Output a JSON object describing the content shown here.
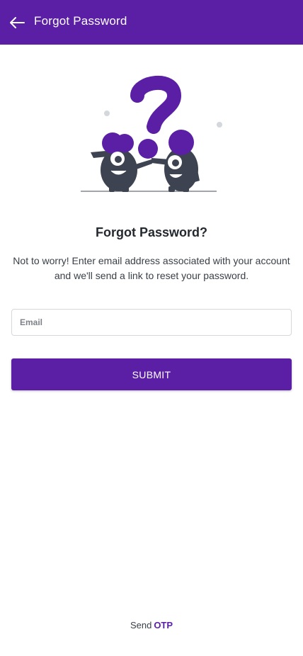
{
  "app_bar": {
    "title": "Forgot Password",
    "back_icon": "arrow-left-icon",
    "color": "#5b1fa6"
  },
  "illustration": {
    "name": "question-mark-monsters-illustration",
    "accent": "#5b1fa6",
    "body_color": "#3d4350"
  },
  "content": {
    "heading": "Forgot Password?",
    "description": "Not to worry! Enter email address associated with your account and we'll send a link to reset your password."
  },
  "form": {
    "email": {
      "placeholder": "Email",
      "value": ""
    },
    "submit_label": "SUBMIT"
  },
  "footer": {
    "send_text": "Send",
    "otp_link": "OTP"
  }
}
